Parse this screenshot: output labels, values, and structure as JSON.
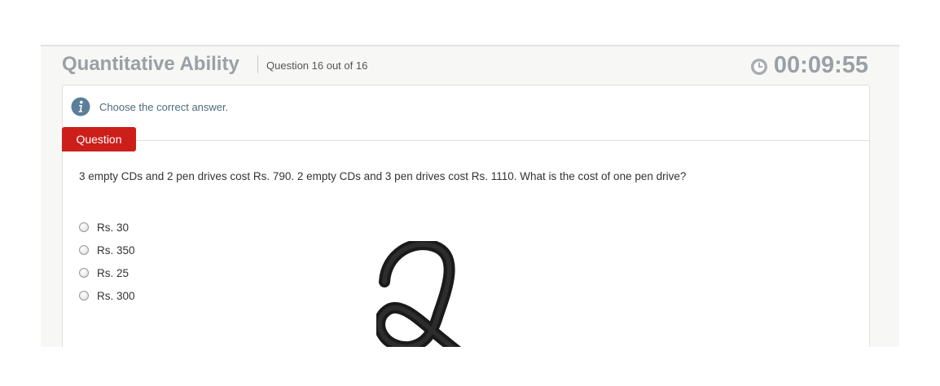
{
  "header": {
    "section_title": "Quantitative Ability",
    "question_counter": "Question 16 out of 16",
    "timer": "00:09:55"
  },
  "instruction": {
    "text": "Choose the correct answer."
  },
  "question": {
    "tab_label": "Question",
    "text": "3 empty CDs and 2 pen drives cost Rs. 790. 2 empty CDs and 3 pen drives cost Rs. 1110. What is the cost of one pen drive?",
    "options": [
      {
        "label": "Rs. 30",
        "selected": false
      },
      {
        "label": "Rs. 350",
        "selected": false
      },
      {
        "label": "Rs. 25",
        "selected": false
      },
      {
        "label": "Rs. 300",
        "selected": false
      }
    ]
  },
  "icons": {
    "timer": "clock-icon",
    "instruction": "info-icon",
    "annotation": "handwritten-two"
  },
  "colors": {
    "accent": "#cc1f1a",
    "title_gray": "#9aa0a6",
    "info_blue": "#5b7f99"
  }
}
